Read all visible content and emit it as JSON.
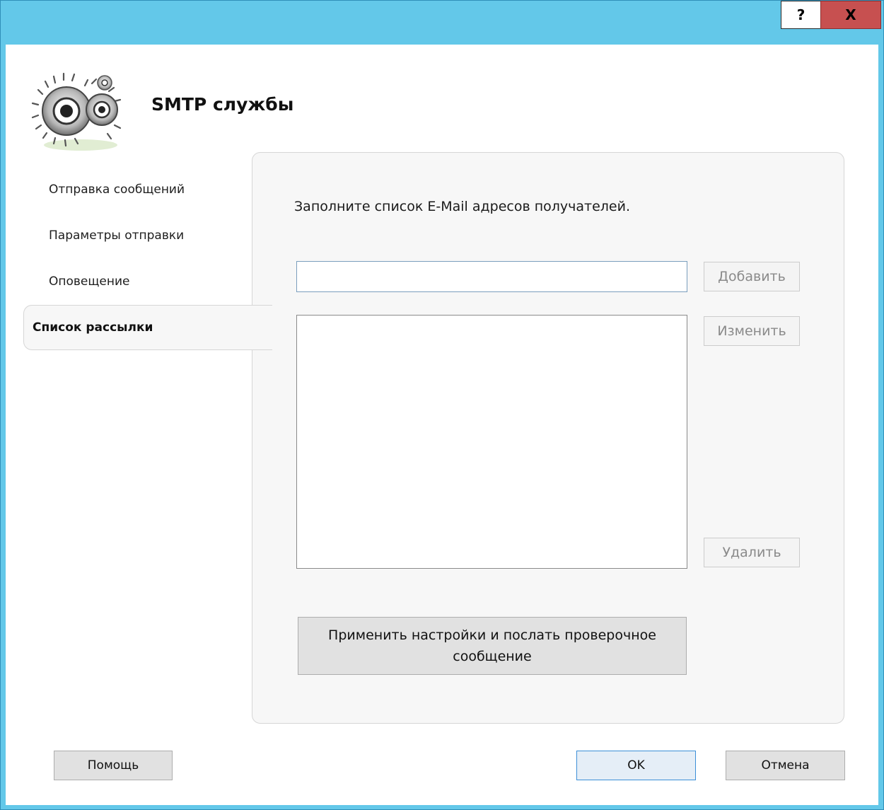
{
  "window": {
    "help_label": "?",
    "close_label": "X"
  },
  "header": {
    "title": "SMTP службы"
  },
  "nav": {
    "items": [
      {
        "label": "Отправка сообщений"
      },
      {
        "label": "Параметры отправки"
      },
      {
        "label": "Оповещение"
      },
      {
        "label": "Список рассылки",
        "active": true
      }
    ]
  },
  "panel": {
    "instruction": "Заполните список E-Mail адресов получателей.",
    "email_input": {
      "value": "",
      "placeholder": ""
    },
    "recipients": [],
    "add_label": "Добавить",
    "edit_label": "Изменить",
    "delete_label": "Удалить",
    "apply_label": "Применить настройки и послать проверочное сообщение"
  },
  "footer": {
    "help_label": "Помощь",
    "ok_label": "OK",
    "cancel_label": "Отмена"
  },
  "colors": {
    "titlebar": "#63c8e9",
    "close": "#c75050",
    "panel": "#f7f7f7"
  }
}
